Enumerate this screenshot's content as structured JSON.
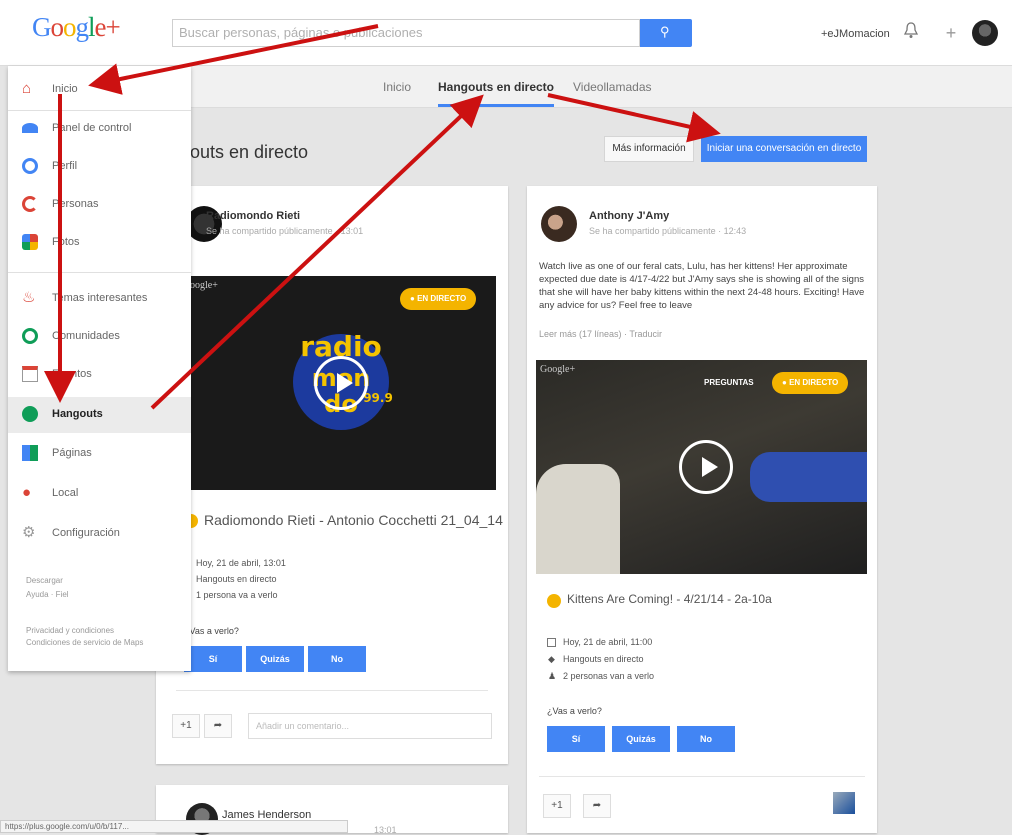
{
  "brand": {
    "name": "Google+"
  },
  "search": {
    "placeholder": "Buscar personas, páginas o publicaciones"
  },
  "header": {
    "user_link": "+eJMomacion"
  },
  "tabs": [
    {
      "label": "Inicio"
    },
    {
      "label": "Hangouts en directo",
      "active": true
    },
    {
      "label": "Videollamadas"
    }
  ],
  "sidebar": {
    "items": [
      {
        "label": "Inicio",
        "icon": "home-icon"
      },
      {
        "label": "Panel de control",
        "icon": "dashboard-icon"
      },
      {
        "label": "Perfil",
        "icon": "profile-icon"
      },
      {
        "label": "Personas",
        "icon": "people-icon"
      },
      {
        "label": "Fotos",
        "icon": "photos-icon"
      },
      {
        "label": "Temas interesantes",
        "icon": "trending-icon"
      },
      {
        "label": "Comunidades",
        "icon": "communities-icon"
      },
      {
        "label": "Eventos",
        "icon": "events-icon"
      },
      {
        "label": "Hangouts",
        "icon": "hangouts-icon",
        "active": true
      },
      {
        "label": "Páginas",
        "icon": "pages-icon"
      },
      {
        "label": "Local",
        "icon": "local-pin-icon"
      },
      {
        "label": "Configuración",
        "icon": "settings-gear-icon"
      }
    ],
    "footer": {
      "line1": "Descargar",
      "line2": "Ayuda · Fiel",
      "line3": "Privacidad y condiciones",
      "line4": "Condiciones de servicio de Maps"
    }
  },
  "page": {
    "title": "outs en directo",
    "more_info": "Más información",
    "start_btn": "Iniciar una conversación en directo"
  },
  "posts": [
    {
      "author": "Radiomondo Rieti",
      "meta": "Se ha compartido públicamente  ·  13:01",
      "badge": "EN DIRECTO",
      "watermark": "oogle+",
      "logo_text": "radio mondo",
      "event_title": "Radiomondo Rieti - Antonio Cocchetti 21_04_14",
      "date": "Hoy, 21 de abril, 13:01",
      "type": "Hangouts en directo",
      "viewers": "1 persona va a verlo",
      "question": "¿Vas a verlo?",
      "rsvp": [
        "Sí",
        "Quizás",
        "No"
      ],
      "plus_one": "+1",
      "comment_placeholder": "Añadir un comentario..."
    },
    {
      "author": "Anthony J'Amy",
      "meta": "Se ha compartido públicamente  ·  12:43",
      "text": "Watch live as one of our feral cats, Lulu, has her kittens! Her approximate expected due date is 4/17-4/22 but J'Amy says she is showing all of the signs that she will have her baby kittens within the next 24-48 hours. Exciting! Have any advice for us? Feel free to leave",
      "read_more": "Leer más (17 líneas)  ·  Traducir",
      "watermark": "Google+",
      "questions_label": "PREGUNTAS",
      "badge": "EN DIRECTO",
      "event_title": "Kittens Are Coming! - 4/21/14 - 2a-10a",
      "date": "Hoy, 21 de abril, 11:00",
      "type": "Hangouts en directo",
      "viewers": "2 personas van a verlo",
      "question": "¿Vas a verlo?",
      "rsvp": [
        "Sí",
        "Quizás",
        "No"
      ],
      "plus_one": "+1"
    },
    {
      "author": "James Henderson",
      "meta": "13:01"
    }
  ],
  "status_bar": "https://plus.google.com/u/0/b/117...",
  "colors": {
    "primary": "#4285f4",
    "live_badge": "#f4b400",
    "arrow": "#cc1111",
    "video_bg": "#1a1a1a"
  }
}
